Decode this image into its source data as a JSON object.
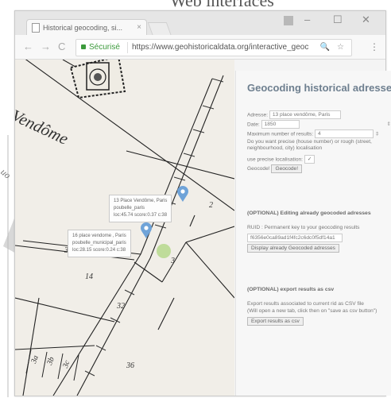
{
  "heading": "Web interfaces",
  "browser": {
    "tab_title": "Historical geocoding, si...",
    "tab_close": "×",
    "window_controls": [
      "–",
      "☐",
      "✕"
    ],
    "nav": [
      "←",
      "→",
      "C"
    ],
    "secure_label": "Sécurisé",
    "url": "https://www.geohistoricaldata.org/interactive_geoc",
    "omnibox_icons": "🔍 ☆",
    "menu_icon": "⋮"
  },
  "panel": {
    "title": "Geocoding historical adresses",
    "address_label": "Adresse:",
    "address_value": "13 place vendôme, Paris",
    "date_label": "Date:",
    "date_value": "1850",
    "max_results_label": "Maximum number of results:",
    "max_results_value": "4",
    "precise_question": "Do you want precise (house number) or rough (street, neighbourhood, city) localisation",
    "precise_label": "use precise localisation:",
    "precise_checked": "✓",
    "geocode_label": "Geocode!",
    "geocode_button": "Geocode!",
    "edit_section": "(OPTIONAL) Editing already geocoded adresses",
    "ruid_label": "RUID : Permanent key to your geocoding results",
    "ruid_value": "f6356e0ca89ad1f4fc2c6dc0f5df14a1",
    "display_button": "Display already Geocoded adresses",
    "export_section": "(OPTIONAL) export results as csv",
    "export_text_1": "Export results associated to current rid as CSV file",
    "export_text_2": "(Will open a new tab, click then on \"save as csv button\")",
    "export_button": "Export results as csv"
  },
  "map": {
    "street_name": "Vendôme",
    "popup1": [
      "13 Place Vendôme, Paris",
      "poubelle_paris",
      "loc:45.74 score:0.37 c:38"
    ],
    "popup2": [
      "16 place vendome , Paris",
      "poubelle_municipal_paris",
      "loc:28.15 score:0.24 c:38"
    ],
    "parcel_labels": [
      "32",
      "31",
      "3",
      "2",
      "3a",
      "3b",
      "14",
      "3c",
      "36"
    ],
    "side_label": "uo"
  },
  "colors": {
    "marker": "#6fa3d8",
    "secure": "#3c9a3c",
    "title": "#6e7f8f"
  }
}
